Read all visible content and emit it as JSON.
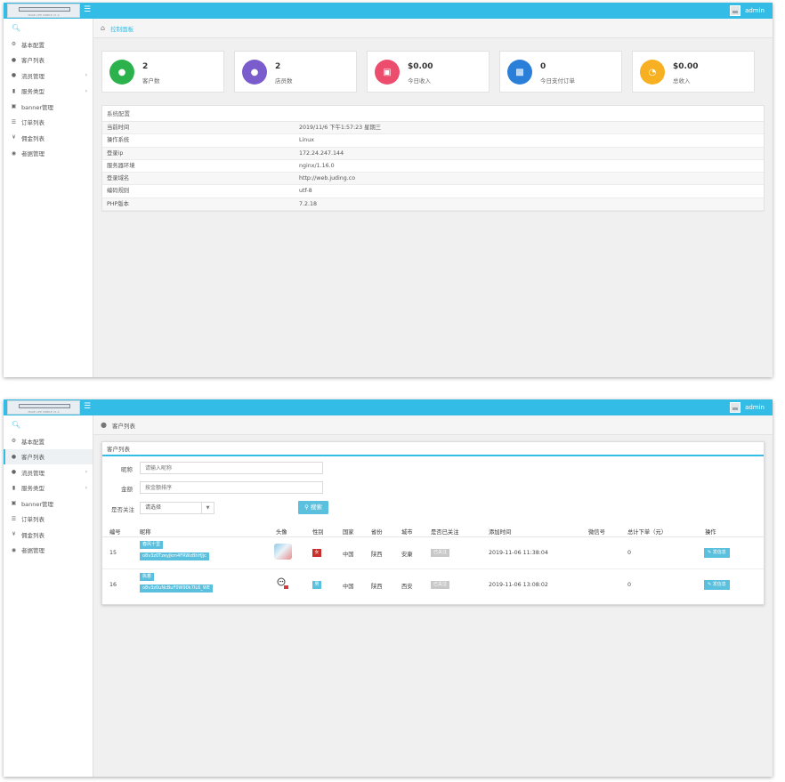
{
  "header": {
    "logo_caption": "MAKE LIFE SIMPLE V1.0",
    "menu_icon": "hamburger-icon",
    "admin_label": "admin"
  },
  "sidebar": {
    "search_icon": "search-icon",
    "items": [
      {
        "label": "基本配置",
        "icon": "gear-icon"
      },
      {
        "label": "客户列表",
        "icon": "user-icon"
      },
      {
        "label": "流员管理",
        "icon": "users-icon",
        "arrow": "›"
      },
      {
        "label": "服务类型",
        "icon": "folder-icon",
        "arrow": "›"
      },
      {
        "label": "banner管理",
        "icon": "image-icon"
      },
      {
        "label": "订单列表",
        "icon": "list-icon"
      },
      {
        "label": "佣金列表",
        "icon": "yen-icon"
      },
      {
        "label": "者据管理",
        "icon": "comment-icon"
      }
    ]
  },
  "dashboard": {
    "breadcrumb": "控制面板",
    "stats": [
      {
        "value": "2",
        "label": "客户数",
        "color": "#2bb24c",
        "icon": "user-icon"
      },
      {
        "value": "2",
        "label": "店员数",
        "color": "#7b5ccc",
        "icon": "users-icon"
      },
      {
        "value": "$0.00",
        "label": "今日收入",
        "color": "#ec4d6d",
        "icon": "laptop-icon"
      },
      {
        "value": "0",
        "label": "今日支付订单",
        "color": "#2a7fd9",
        "icon": "money-icon"
      },
      {
        "value": "$0.00",
        "label": "总收入",
        "color": "#f6b022",
        "icon": "pie-chart-icon"
      }
    ],
    "system": {
      "title": "系统配置",
      "rows": [
        {
          "key": "当前时间",
          "value": "2019/11/6 下午1:57:23 星期三"
        },
        {
          "key": "操作系统",
          "value": "Linux"
        },
        {
          "key": "登录ip",
          "value": "172.24.247.144"
        },
        {
          "key": "服务器环境",
          "value": "nginx/1.16.0"
        },
        {
          "key": "登录域名",
          "value": "http://web.juding.co"
        },
        {
          "key": "编码规则",
          "value": "utf-8"
        },
        {
          "key": "PHP版本",
          "value": "7.2.18"
        }
      ]
    }
  },
  "customers": {
    "breadcrumb": "客户列表",
    "box_title": "客户列表",
    "filters": {
      "nickname_label": "昵称",
      "nickname_placeholder": "请输入昵称",
      "amount_label": "金额",
      "amount_placeholder": "按金额排序",
      "follow_label": "是否关注",
      "follow_value": "请选择",
      "search_label": "搜索"
    },
    "columns": [
      "编号",
      "昵称",
      "头像",
      "性别",
      "国家",
      "省份",
      "城市",
      "是否已关注",
      "添加时间",
      "微信号",
      "总计下单（元）",
      "操作"
    ],
    "rows": [
      {
        "id": "15",
        "name": "春风十里",
        "openid": "o8v3z0Tzeyjkm4FRWzBhHJjc",
        "gender": "女",
        "country": "中国",
        "province": "陕西",
        "city": "安康",
        "followed": "已关注",
        "added": "2019-11-06 11:38:04",
        "wechat": "",
        "total": "0",
        "action": "发信息"
      },
      {
        "id": "16",
        "name": "执着",
        "openid": "o8v3z0uNcBuF0W90k7IL6_WE",
        "gender": "男",
        "country": "中国",
        "province": "陕西",
        "city": "西安",
        "followed": "已关注",
        "added": "2019-11-06 13:08:02",
        "wechat": "",
        "total": "0",
        "action": "发信息"
      }
    ]
  }
}
